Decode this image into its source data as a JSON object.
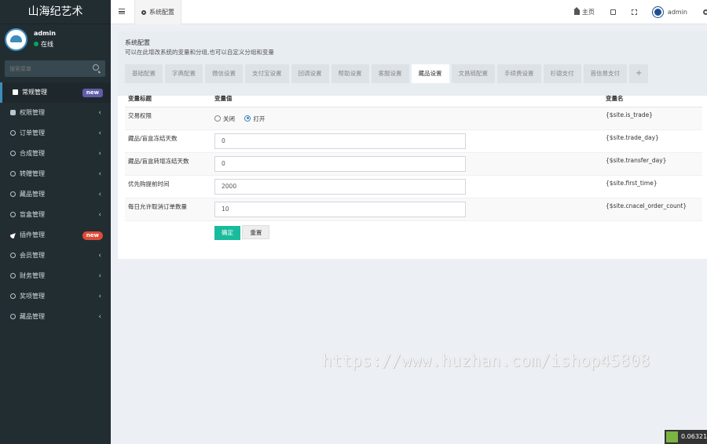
{
  "app": {
    "title": "山海纪艺术"
  },
  "user": {
    "name": "admin",
    "status": "在线"
  },
  "search": {
    "placeholder": "搜索菜单"
  },
  "menu": [
    {
      "label": "常规管理",
      "badge": "new",
      "badge_color": "#605ca8"
    },
    {
      "label": "权限管理"
    },
    {
      "label": "订单管理"
    },
    {
      "label": "合成管理"
    },
    {
      "label": "转赠管理"
    },
    {
      "label": "藏品管理"
    },
    {
      "label": "盲盒管理"
    },
    {
      "label": "插件管理",
      "badge": "new",
      "badge_color": "#dd4b39"
    },
    {
      "label": "会员管理"
    },
    {
      "label": "财务管理"
    },
    {
      "label": "奖项管理"
    },
    {
      "label": "藏品管理"
    }
  ],
  "header": {
    "tab_label": "系统配置",
    "home_label": "主页",
    "user_name": "admin"
  },
  "page": {
    "title": "系统配置",
    "description": "可以在此增改系统的变量和分组,也可以自定义分组和变量"
  },
  "tabs": [
    "基础配置",
    "字典配置",
    "微信设置",
    "支付宝设置",
    "回调设置",
    "帮助设置",
    "客服设置",
    "藏品设置",
    "文昌链配置",
    "手续费设置",
    "杉德支付",
    "首信易支付",
    "+"
  ],
  "active_tab": "藏品设置",
  "table": {
    "headers": [
      "变量标题",
      "变量值",
      "变量名"
    ],
    "rows": [
      {
        "title": "交易权限",
        "type": "radio",
        "name": "{$site.is_trade}",
        "options": [
          "关闭",
          "打开"
        ],
        "selected": "打开"
      },
      {
        "title": "藏品/盲盒冻结天数",
        "type": "input",
        "value": "0",
        "name": "{$site.trade_day}"
      },
      {
        "title": "藏品/盲盒转增冻结天数",
        "type": "input",
        "value": "0",
        "name": "{$site.transfer_day}"
      },
      {
        "title": "优先购提前时间",
        "type": "input",
        "value": "2000",
        "name": "{$site.first_time}"
      },
      {
        "title": "每日允许取消订单数量",
        "type": "input",
        "value": "10",
        "name": "{$site.cnacel_order_count}"
      }
    ]
  },
  "buttons": {
    "submit": "确定",
    "reset": "重置"
  },
  "watermark": "https://www.huzhan.com/ishop45808",
  "corner_value": "0.06321"
}
